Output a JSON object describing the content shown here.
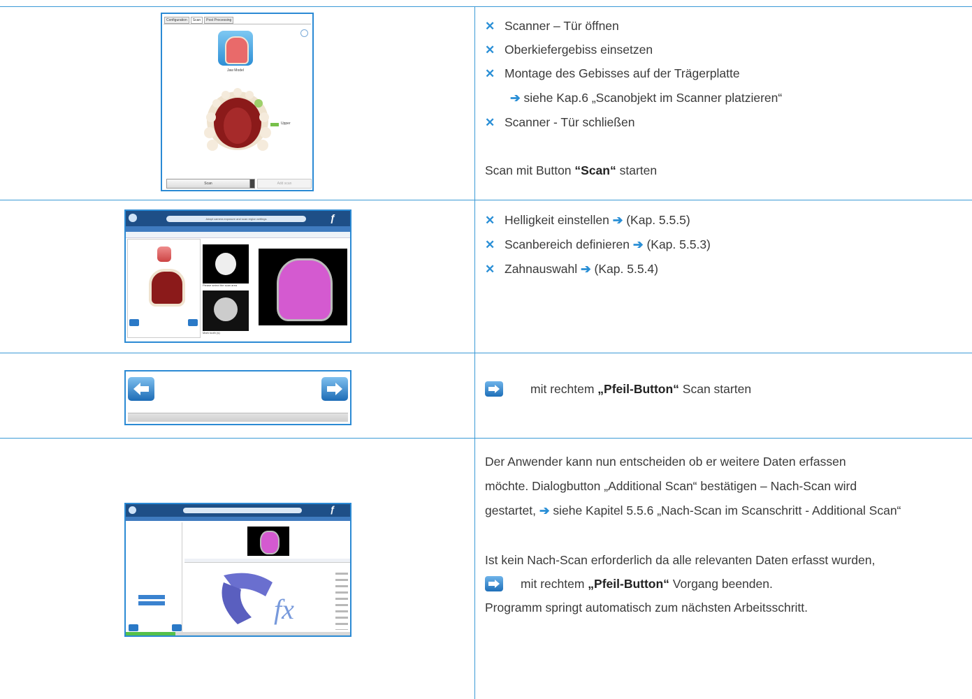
{
  "row1": {
    "items": [
      "Scanner – Tür öffnen",
      "Oberkiefergebiss einsetzen",
      "Montage des Gebisses auf der Trägerplatte",
      "siehe Kap.6 „Scanobjekt im Scanner platzieren“",
      "Scanner - Tür schließen"
    ],
    "start_pre": "Scan mit Button ",
    "start_bold": "“Scan“",
    "start_post": " starten",
    "screenshot": {
      "tabs": [
        "Configuration",
        "Scan",
        "Post Processing"
      ],
      "model_label": "Jaw Model",
      "upper_label": "Upper",
      "scan_button": "Scan",
      "add_button": "Add scan"
    }
  },
  "row2": {
    "items": [
      {
        "text": "Helligkeit einstellen",
        "ref": "(Kap. 5.5.5)"
      },
      {
        "text": "Scanbereich definieren",
        "ref": "(Kap. 5.5.3)"
      },
      {
        "text": "Zahnauswahl",
        "ref": "(Kap. 5.5.4)"
      }
    ],
    "screenshot": {
      "search_text": "Adapt camera exposure and scan region settings",
      "hint1": "Please select the scan area",
      "hint2": "Mark tooth (s)"
    }
  },
  "row3": {
    "pre": "mit rechtem ",
    "bold": "„Pfeil-Button“",
    "post": " Scan starten"
  },
  "row4": {
    "line1": "Der Anwender kann nun entscheiden ob er weitere Daten erfassen",
    "line2": "möchte. Dialogbutton „Additional Scan“ bestätigen – Nach-Scan wird",
    "line3_pre": "gestartet, ",
    "line3_post": " siehe Kapitel 5.5.6 „Nach-Scan im Scanschritt - Additional Scan“",
    "line4": "Ist kein Nach-Scan erforderlich da alle relevanten Daten erfasst wurden,",
    "line5_pre": "mit rechtem ",
    "line5_bold": "„Pfeil-Button“",
    "line5_post": " Vorgang beenden.",
    "line6": "Programm springt automatisch zum nächsten Arbeitsschritt."
  },
  "colors": {
    "accent": "#2a8fd6",
    "rule": "#3b9ad6",
    "gum": "#8b1a1a",
    "scan_pink": "#d45ad0"
  }
}
